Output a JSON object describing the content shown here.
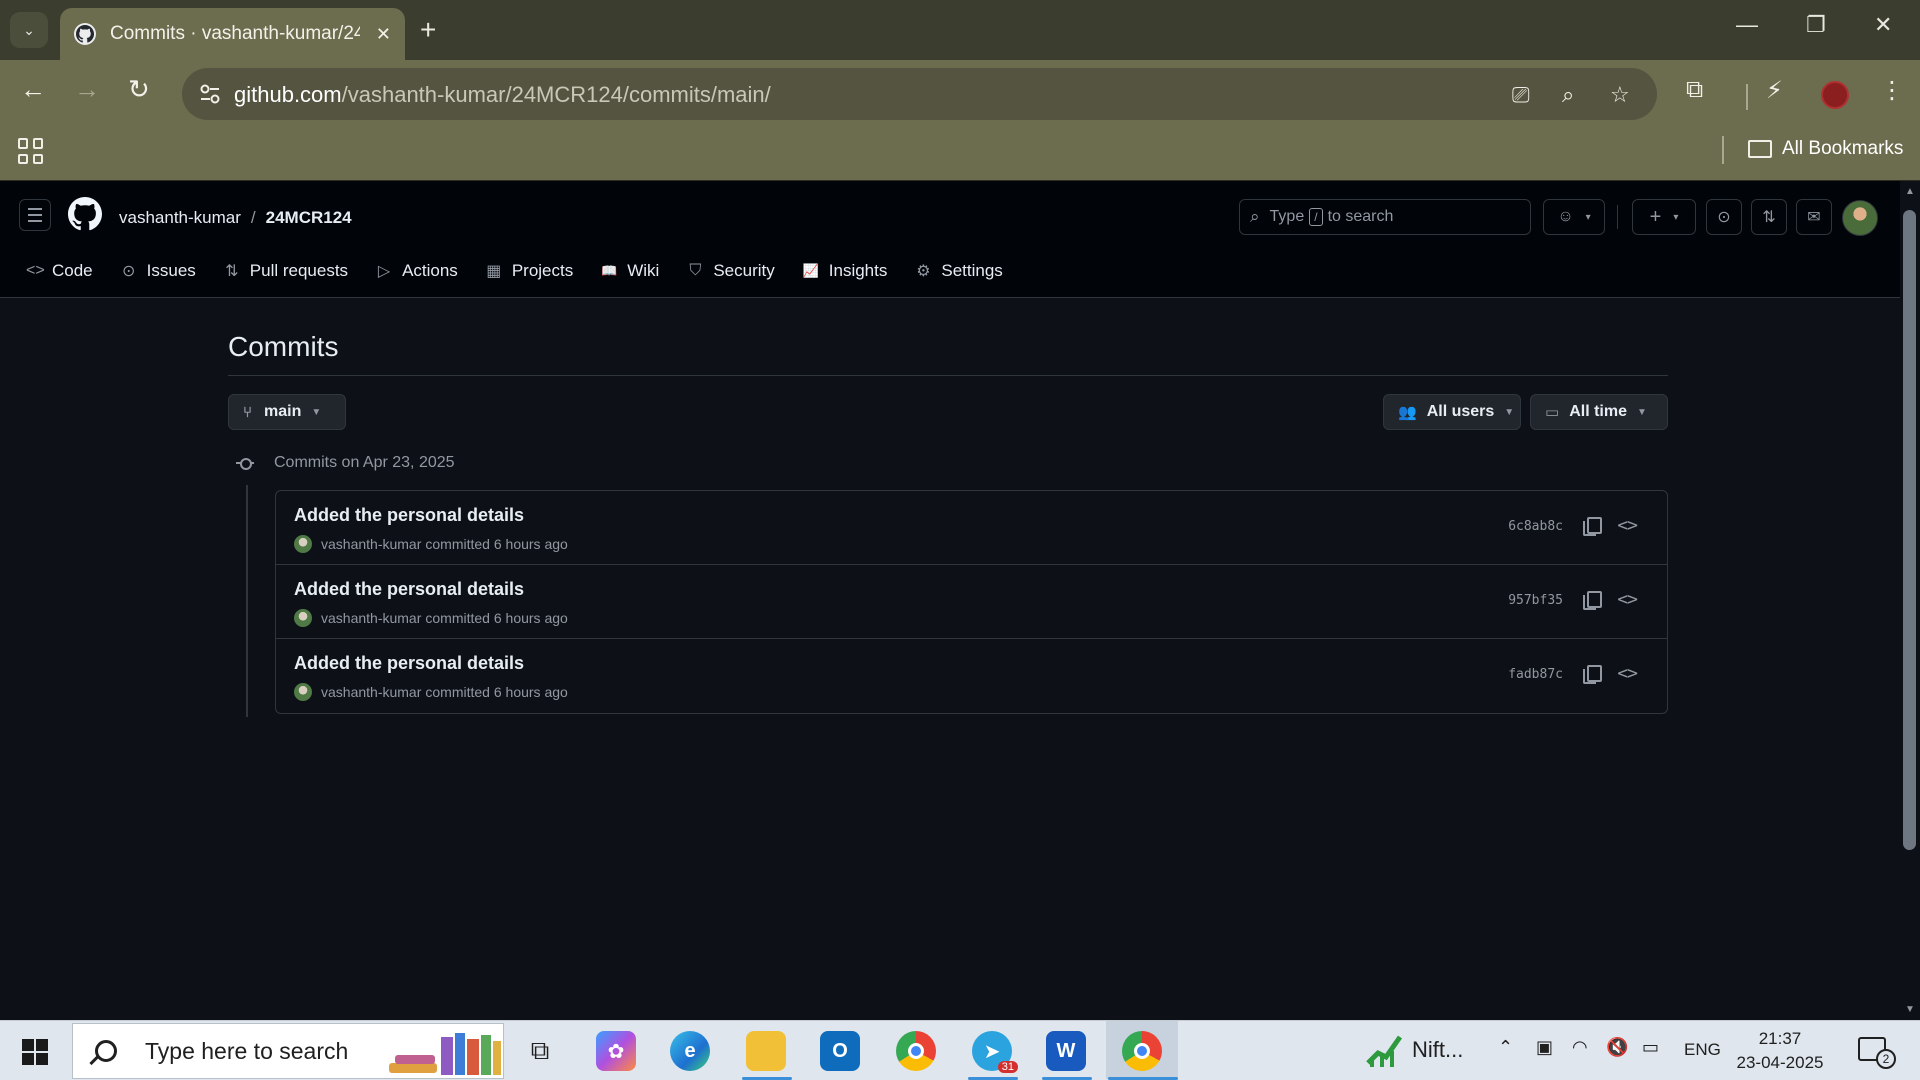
{
  "browser": {
    "tab_title": "Commits · vashanth-kumar/24MCR124",
    "tab_close": "✕",
    "new_tab": "+",
    "url_host": "github.com",
    "url_path": "/vashanth-kumar/24MCR124/commits/main/",
    "bookmarks_label": "All Bookmarks",
    "window_controls": [
      "—",
      "❐",
      "✕"
    ]
  },
  "github": {
    "owner": "vashanth-kumar",
    "separator": "/",
    "repo": "24MCR124",
    "search_prefix": "Type",
    "search_key": "/",
    "search_suffix": "to search",
    "repo_nav": [
      {
        "label": "Code",
        "icon": "code-icon",
        "glyph": "<>"
      },
      {
        "label": "Issues",
        "icon": "issue-icon",
        "glyph": "⊙"
      },
      {
        "label": "Pull requests",
        "icon": "pull-request-icon",
        "glyph": "⇅"
      },
      {
        "label": "Actions",
        "icon": "play-icon",
        "glyph": "▷"
      },
      {
        "label": "Projects",
        "icon": "table-icon",
        "glyph": "▦"
      },
      {
        "label": "Wiki",
        "icon": "book-icon",
        "glyph": "📖"
      },
      {
        "label": "Security",
        "icon": "shield-icon",
        "glyph": "⛉"
      },
      {
        "label": "Insights",
        "icon": "graph-icon",
        "glyph": "📈"
      },
      {
        "label": "Settings",
        "icon": "gear-icon",
        "glyph": "⚙"
      }
    ]
  },
  "page": {
    "title": "Commits",
    "branch": "main",
    "users_filter": "All users",
    "time_filter": "All time",
    "group_heading": "Commits on Apr 23, 2025",
    "commits": [
      {
        "message": "Added the personal details",
        "author": "vashanth-kumar",
        "action": "committed 6 hours ago",
        "sha": "6c8ab8c"
      },
      {
        "message": "Added the personal details",
        "author": "vashanth-kumar",
        "action": "committed 6 hours ago",
        "sha": "957bf35"
      },
      {
        "message": "Added the personal details",
        "author": "vashanth-kumar",
        "action": "committed 6 hours ago",
        "sha": "fadb87c"
      }
    ]
  },
  "taskbar": {
    "search_placeholder": "Type here to search",
    "nifty_label": "Nift...",
    "telegram_badge": "31",
    "language": "ENG",
    "time": "21:37",
    "date": "23-04-2025",
    "notification_count": "2"
  },
  "colors": {
    "page_bg": "#0d1117",
    "header_bg": "#010409",
    "border": "#30363d",
    "muted_text": "#9198a1",
    "browser_frame": "#6c6c4e"
  }
}
